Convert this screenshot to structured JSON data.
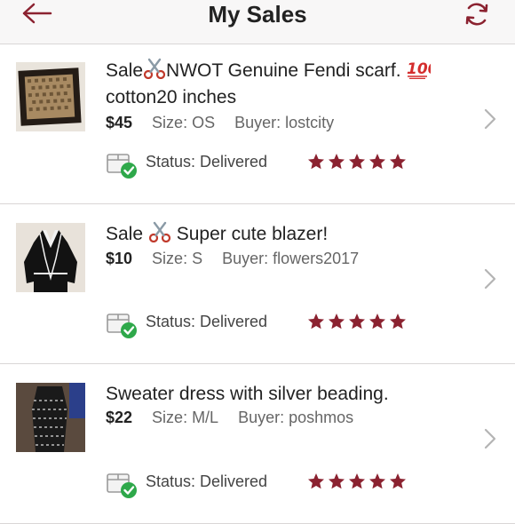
{
  "header": {
    "title": "My Sales",
    "back_icon": "arrow-left-icon",
    "refresh_icon": "refresh-icon"
  },
  "colors": {
    "accent": "#8b2230",
    "star": "#8b2230",
    "check": "#2ea84a",
    "divider": "#d9d6d6"
  },
  "sales": [
    {
      "title_part1": "Sale",
      "title_part2": "NWOT Genuine Fendi scarf.",
      "title_part3": "cotton20 inches",
      "price": "$45",
      "size_label": "Size: OS",
      "buyer_label": "Buyer: lostcity",
      "status_label": "Status:  Delivered",
      "rating": 5
    },
    {
      "title_part1": "Sale",
      "title_part2": "Super cute blazer!",
      "price": "$10",
      "size_label": "Size: S",
      "buyer_label": "Buyer: flowers2017",
      "status_label": "Status:  Delivered",
      "rating": 5
    },
    {
      "title_part1": "Sweater dress with silver beading.",
      "price": "$22",
      "size_label": "Size: M/L",
      "buyer_label": "Buyer: poshmos",
      "status_label": "Status:  Delivered",
      "rating": 5
    }
  ]
}
